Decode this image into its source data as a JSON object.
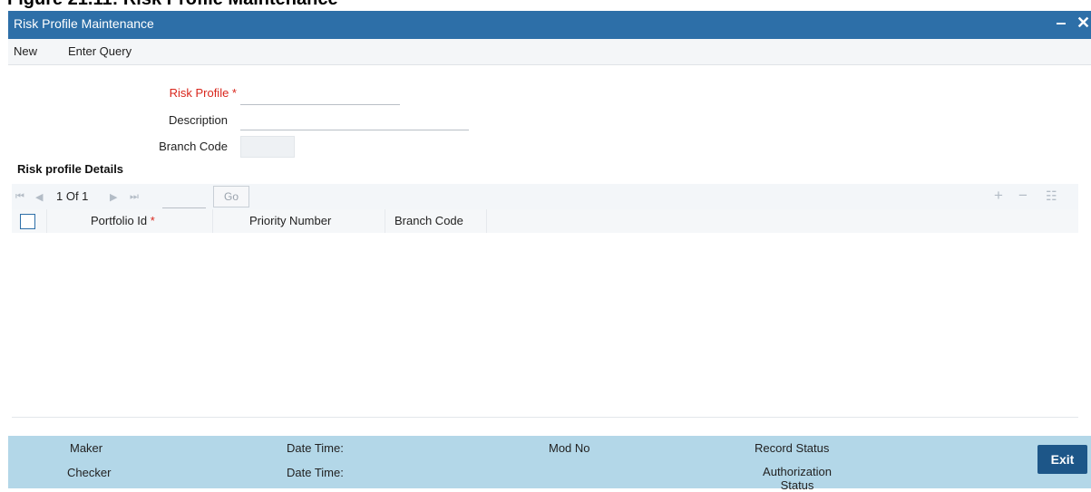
{
  "caption": "Figure 21.11: Risk Profile Maintenance",
  "window": {
    "title": "Risk Profile Maintenance",
    "minimize": "‒",
    "close": "✕"
  },
  "menu": {
    "new": "New",
    "enter_query": "Enter Query"
  },
  "form": {
    "risk_profile_label": "Risk Profile *",
    "risk_profile_value": "",
    "description_label": "Description",
    "description_value": "",
    "branch_code_label": "Branch Code",
    "branch_code_value": ""
  },
  "details": {
    "title": "Risk profile Details",
    "pager": {
      "text": "1 Of 1",
      "go": "Go"
    },
    "columns": {
      "portfolio_id": "Portfolio Id",
      "required_star": "*",
      "priority_number": "Priority Number",
      "branch_code": "Branch Code"
    },
    "rows": []
  },
  "footer": {
    "maker": "Maker",
    "checker": "Checker",
    "date_time_1": "Date Time:",
    "date_time_2": "Date Time:",
    "mod_no": "Mod No",
    "record_status": "Record Status",
    "authorization_status": "Authorization Status",
    "exit": "Exit"
  },
  "colors": {
    "title_bar": "#2d6fa8",
    "footer": "#b3d7e8",
    "exit_button": "#1d5688",
    "required": "#d9261c"
  }
}
